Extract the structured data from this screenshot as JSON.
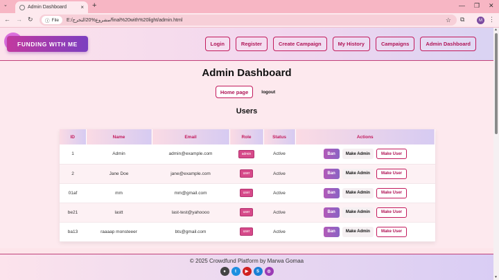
{
  "browser": {
    "tab_title": "Admin Dashboard",
    "url_chip": "File",
    "url": "E:/مشروع%20التخرج/final%20with%20light/admin.html",
    "avatar": "M",
    "icons": {
      "back": "arrow-left-icon",
      "forward": "arrow-right-icon",
      "reload": "reload-icon",
      "info": "info-icon",
      "star": "star-icon",
      "extensions": "puzzle-icon",
      "menu": "kebab-menu-icon"
    }
  },
  "header": {
    "logo_text": "FUNDING WITH ME",
    "nav": [
      "Login",
      "Register",
      "Create Campaign",
      "My History",
      "Campaigns",
      "Admin Dashboard"
    ]
  },
  "main": {
    "title": "Admin Dashboard",
    "home_button": "Home page",
    "logout": "logout",
    "section_title": "Users"
  },
  "table": {
    "headers": [
      "ID",
      "Name",
      "Email",
      "Role",
      "Status",
      "Actions"
    ],
    "rows": [
      {
        "id": "1",
        "name": "Admin",
        "email": "admin@example.com",
        "role": "admin",
        "status": "Active"
      },
      {
        "id": "2",
        "name": "Jane Doe",
        "email": "jane@example.com",
        "role": "user",
        "status": "Active"
      },
      {
        "id": "01af",
        "name": "mm",
        "email": "mm@gmail.com",
        "role": "user",
        "status": "Active"
      },
      {
        "id": "be21",
        "name": "lastt",
        "email": "last-test@yahoooo",
        "role": "user",
        "status": "Active"
      },
      {
        "id": "ba13",
        "name": "raaaap monsteeer",
        "email": "bts@gmail.com",
        "role": "user",
        "status": "Active"
      }
    ],
    "actions": {
      "ban": "Ban",
      "make_admin": "Make Admin",
      "make_user": "Make User"
    }
  },
  "footer": {
    "copyright": "© 2025 Crowdfund Platform by Marwa Gomaa",
    "socials": [
      {
        "name": "github-icon",
        "color": "#444"
      },
      {
        "name": "twitter-icon",
        "color": "#1d8fe0"
      },
      {
        "name": "youtube-icon",
        "color": "#d02020"
      },
      {
        "name": "skype-icon",
        "color": "#1a80d6"
      },
      {
        "name": "instagram-icon",
        "color": "#9b3bb5"
      }
    ]
  }
}
